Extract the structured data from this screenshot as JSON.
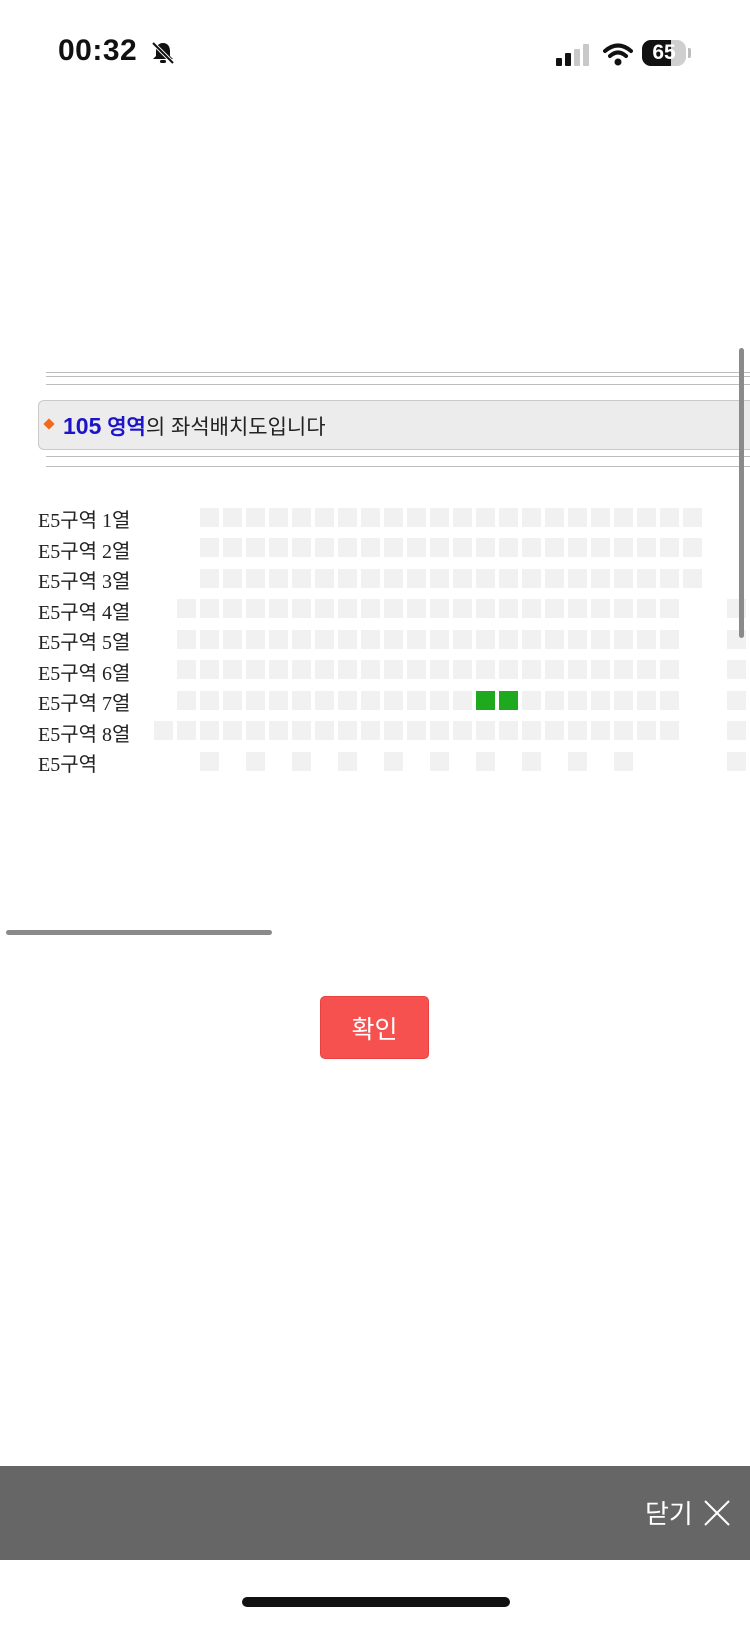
{
  "status_bar": {
    "time": "00:32",
    "battery": "65",
    "battery_level": 0.65,
    "icons": [
      "bell-slash-icon",
      "cellular-signal-icon",
      "wifi-icon",
      "battery-icon"
    ]
  },
  "zone_header": {
    "number": "105",
    "label": "영역",
    "suffix": "의 좌석배치도입니다"
  },
  "rows": [
    {
      "label": "E5구역 1열",
      "seat_count": 22,
      "selected": []
    },
    {
      "label": "E5구역 2열",
      "seat_count": 22,
      "selected": []
    },
    {
      "label": "E5구역 3열",
      "seat_count": 22,
      "selected": []
    },
    {
      "label": "E5구역 4열",
      "seat_count": 23,
      "selected": []
    },
    {
      "label": "E5구역 5열",
      "seat_count": 23,
      "selected": []
    },
    {
      "label": "E5구역 6열",
      "seat_count": 23,
      "selected": []
    },
    {
      "label": "E5구역 7열",
      "seat_count": 23,
      "selected": [
        13,
        14
      ]
    },
    {
      "label": "E5구역 8열",
      "seat_count": 24,
      "selected": []
    },
    {
      "label": "E5구역",
      "seat_count": 11,
      "selected": []
    }
  ],
  "confirm_button": "확인",
  "bottom_bar": {
    "close_label": "닫기"
  },
  "colors": {
    "seat_available": "#f1f1f1",
    "seat_selected": "#1ea91e",
    "confirm": "#f7514f",
    "zone_text": "#1d14c9",
    "bottom_bar": "#666666"
  }
}
